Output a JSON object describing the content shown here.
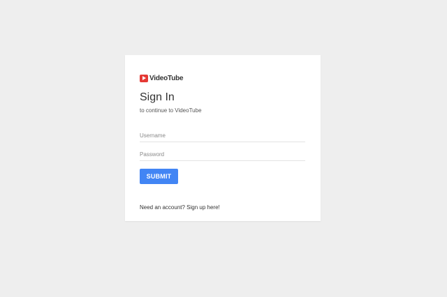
{
  "brand": {
    "name": "VideoTube",
    "icon": "play-icon",
    "icon_color": "#e53935"
  },
  "signin": {
    "title": "Sign In",
    "subtitle": "to continue to VideoTube"
  },
  "form": {
    "username_placeholder": "Username",
    "username_value": "",
    "password_placeholder": "Password",
    "password_value": "",
    "submit_label": "SUBMIT",
    "submit_color": "#4285f4"
  },
  "footer": {
    "signup_link": "Need an account? Sign up here!"
  }
}
